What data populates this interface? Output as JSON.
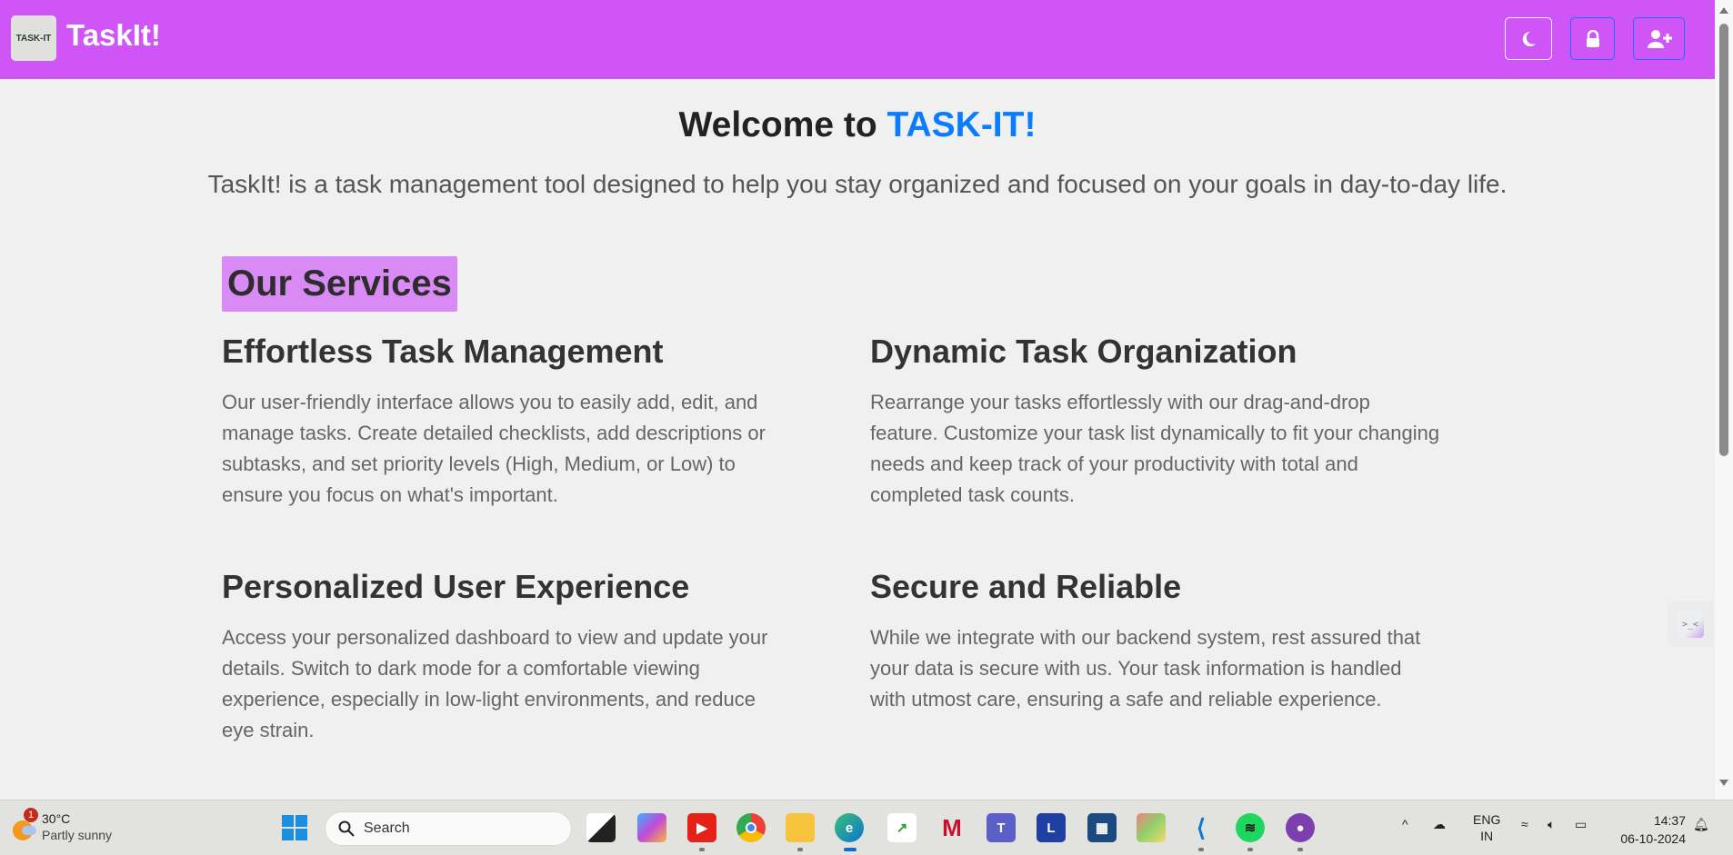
{
  "header": {
    "logo_text": "TASK-IT",
    "brand": "TaskIt!",
    "buttons": [
      {
        "icon": "moon-icon"
      },
      {
        "icon": "lock-icon"
      },
      {
        "icon": "user-plus-icon"
      }
    ]
  },
  "main": {
    "title_prefix": "Welcome to ",
    "title_accent": "TASK-IT!",
    "subtitle": "TaskIt! is a task management tool designed to help you stay organized and focused on your goals in day-to-day life.",
    "services_heading": "Our Services",
    "services": [
      {
        "title": "Effortless Task Management",
        "lines": [
          "Our user-friendly interface allows you to easily add, edit, and",
          "manage tasks. Create detailed checklists, add descriptions or",
          "subtasks, and set priority levels (High, Medium, or Low) to",
          "ensure you focus on what's important."
        ]
      },
      {
        "title": "Dynamic Task Organization",
        "lines": [
          "Rearrange your tasks effortlessly with our drag-and-drop",
          "feature. Customize your task list dynamically to fit your changing",
          "needs and keep track of your productivity with total and",
          "completed task counts."
        ]
      },
      {
        "title": "Personalized User Experience",
        "lines": [
          "Access your personalized dashboard to view and update your",
          "details. Switch to dark mode for a comfortable viewing",
          "experience, especially in low-light environments, and reduce",
          "eye strain."
        ]
      },
      {
        "title": "Secure and Reliable",
        "lines": [
          "While we integrate with our backend system, rest assured that",
          "your data is secure with us. Your task information is handled",
          "with utmost care, ensuring a safe and reliable experience."
        ]
      }
    ],
    "float_widget": ">_<"
  },
  "taskbar": {
    "weather_temp": "30°C",
    "weather_desc": "Partly sunny",
    "weather_badge": "1",
    "search_placeholder": "Search",
    "lang_top": "ENG",
    "lang_bottom": "IN",
    "time": "14:37",
    "date": "06-10-2024"
  },
  "colors": {
    "header": "#cf55f7",
    "accent": "#0a7cff",
    "services_bg": "#d98af5"
  }
}
